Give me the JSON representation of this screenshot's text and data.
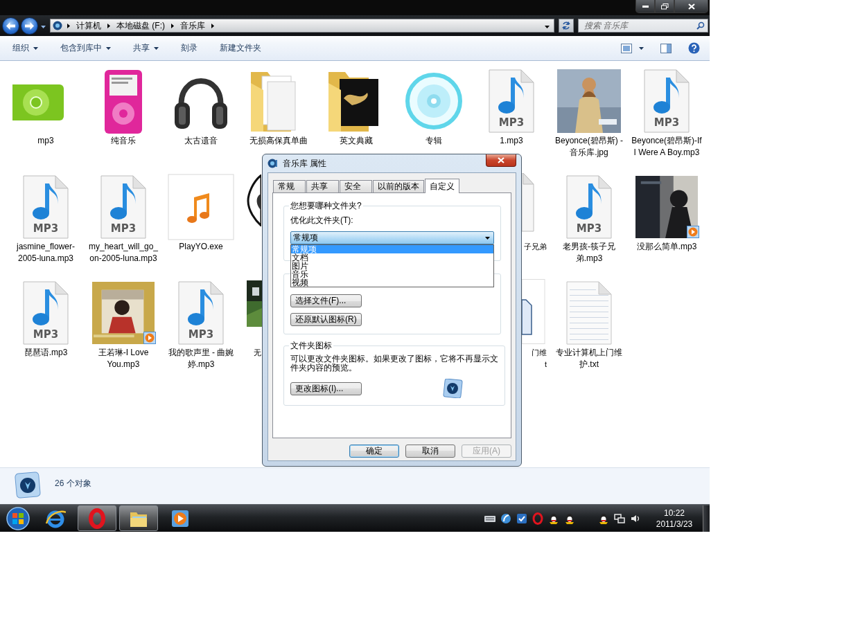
{
  "address_bar": {
    "crumbs": [
      "计算机",
      "本地磁盘 (F:)",
      "音乐库"
    ]
  },
  "search": {
    "placeholder": "搜索 音乐库"
  },
  "toolbar": [
    {
      "label": "组织",
      "menu": true
    },
    {
      "label": "包含到库中",
      "menu": true
    },
    {
      "label": "共享",
      "menu": true
    },
    {
      "label": "刻录",
      "menu": false
    },
    {
      "label": "新建文件夹",
      "menu": false
    }
  ],
  "items": [
    [
      {
        "kind": "shuffle",
        "label": "mp3"
      },
      {
        "kind": "ipod",
        "label": "纯音乐"
      },
      {
        "kind": "headphones",
        "label": "太古遗音"
      },
      {
        "kind": "folder",
        "label": "无损高保真单曲"
      },
      {
        "kind": "folder-art",
        "label": "英文典藏"
      },
      {
        "kind": "disc",
        "label": "专辑"
      },
      {
        "kind": "mp3",
        "icon_text": "MP3",
        "label": "1.mp3"
      },
      {
        "kind": "picture",
        "label": "Beyonce(碧昂斯) - 音乐库.jpg"
      },
      {
        "kind": "mp3",
        "icon_text": "MP3",
        "label": "Beyonce(碧昂斯)-If I Were A Boy.mp3"
      }
    ],
    [
      {
        "kind": "mp3",
        "icon_text": "MP3",
        "label": "jasmine_flower-2005-luna.mp3"
      },
      {
        "kind": "mp3",
        "icon_text": "MP3",
        "label": "my_heart_will_go_on-2005-luna.mp3"
      },
      {
        "kind": "exe",
        "label": "PlayYO.exe"
      },
      {
        "kind": "sticker-fragment"
      },
      {
        "kind": "covered"
      },
      {
        "kind": "covered"
      },
      {
        "kind": "file-fragment",
        "label": "子兄弟"
      },
      {
        "kind": "mp3",
        "icon_text": "MP3",
        "label": "老男孩-筷子兄弟.mp3"
      },
      {
        "kind": "album-dark",
        "label": "没那么简单.mp3"
      }
    ],
    [
      {
        "kind": "mp3",
        "icon_text": "MP3",
        "label": "琵琶语.mp3"
      },
      {
        "kind": "album-warm",
        "label": "王若琳-I Love You.mp3"
      },
      {
        "kind": "mp3",
        "icon_text": "MP3",
        "label": "我的歌声里 - 曲婉婷.mp3"
      },
      {
        "kind": "photo-fragment",
        "label": "无"
      },
      {
        "kind": "covered"
      },
      {
        "kind": "covered"
      },
      {
        "kind": "document-fragment",
        "label": "门维\nt"
      },
      {
        "kind": "txt",
        "label": "专业计算机上门维护.txt"
      }
    ]
  ],
  "status_bar": {
    "text": "26 个对象"
  },
  "dialog": {
    "title": "音乐库 属性",
    "tabs": [
      {
        "label": "常规",
        "selected": false
      },
      {
        "label": "共享",
        "selected": false
      },
      {
        "label": "安全",
        "selected": false
      },
      {
        "label": "以前的版本",
        "selected": false
      },
      {
        "label": "自定义",
        "selected": true
      }
    ],
    "folder_type": {
      "legend": "您想要哪种文件夹?",
      "label": "优化此文件夹(T):",
      "value": "常规项",
      "expanded": true,
      "options": [
        {
          "label": "常规项",
          "selected": true
        },
        {
          "label": "文档",
          "selected": false
        },
        {
          "label": "图片",
          "selected": false
        },
        {
          "label": "音乐",
          "selected": false
        },
        {
          "label": "视频",
          "selected": false
        }
      ]
    },
    "file_buttons": [
      "选择文件(F)...",
      "还原默认图标(R)"
    ],
    "folder_icon": {
      "legend": "文件夹图标",
      "description": "可以更改文件夹图标。如果更改了图标，它将不再显示文件夹内容的预览。",
      "button": "更改图标(I)..."
    },
    "buttons": [
      {
        "label": "确定",
        "default": true,
        "disabled": false
      },
      {
        "label": "取消",
        "default": false,
        "disabled": false
      },
      {
        "label": "应用(A)",
        "default": false,
        "disabled": true
      }
    ]
  },
  "taskbar": {
    "apps": [
      {
        "kind": "browser",
        "active": false
      },
      {
        "kind": "ring",
        "active": true
      },
      {
        "kind": "folder",
        "active": true
      },
      {
        "kind": "player",
        "active": false
      }
    ],
    "tray": [
      {
        "kind": "keyboard"
      },
      {
        "kind": "globe"
      },
      {
        "kind": "check"
      },
      {
        "kind": "ring"
      },
      {
        "kind": "chat"
      },
      {
        "kind": "chat"
      },
      {
        "kind": "chat"
      },
      {
        "kind": "network"
      },
      {
        "kind": "volume"
      }
    ],
    "clock": {
      "time": "10:22",
      "date": "2011/3/23"
    }
  }
}
